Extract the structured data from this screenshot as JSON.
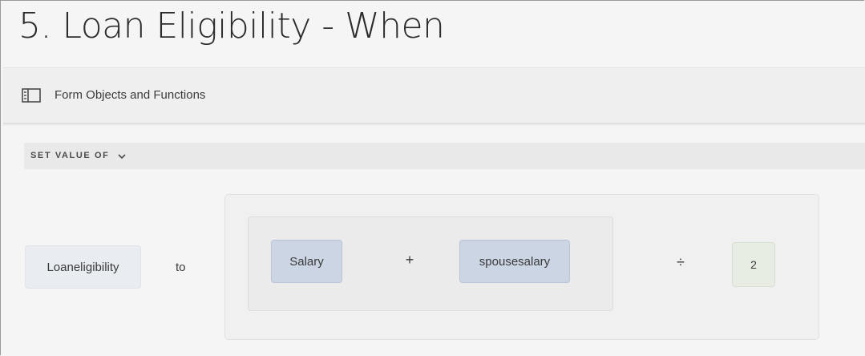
{
  "page": {
    "title": "5. Loan Eligibility - When"
  },
  "toolbar": {
    "form_objects_label": "Form Objects and Functions",
    "icon": "form-objects-panel-icon"
  },
  "rule": {
    "set_value_label": "SET VALUE OF",
    "dropdown_icon": "chevron-down-icon",
    "target_field": "Loaneligibility",
    "connector": "to",
    "expression": {
      "left_operand": "Salary",
      "inner_operator": "+",
      "right_operand": "spousesalary",
      "outer_operator": "÷",
      "divisor": "2"
    }
  },
  "colors": {
    "field_chip": "#cbd5e3",
    "target_chip": "#e9edf2",
    "number_chip": "#e8ede4",
    "background": "#f5f5f5"
  }
}
